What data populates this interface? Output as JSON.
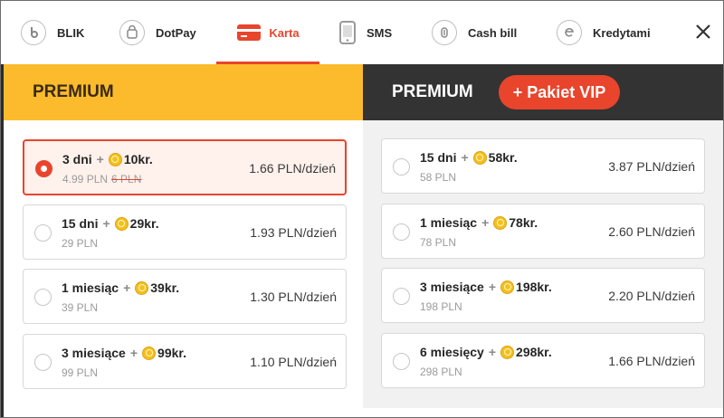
{
  "tabs": [
    {
      "label": "BLIK",
      "icon": "blik-icon"
    },
    {
      "label": "DotPay",
      "icon": "dotpay-icon"
    },
    {
      "label": "Karta",
      "icon": "card-icon",
      "active": true
    },
    {
      "label": "SMS",
      "icon": "sms-icon"
    },
    {
      "label": "Cash bill",
      "icon": "cashbill-icon"
    },
    {
      "label": "Kredytami",
      "icon": "credits-icon"
    }
  ],
  "colors": {
    "accent": "#e8452c",
    "premium_yellow": "#fbbb2c",
    "dark": "#333333",
    "coin": "#f4c01c"
  },
  "premium": {
    "title": "PREMIUM",
    "plans": [
      {
        "duration": "3 dni",
        "plus": "+",
        "credits": "10kr.",
        "price": "4.99 PLN",
        "old_price": "6 PLN",
        "per_day": "1.66 PLN/dzień",
        "selected": true
      },
      {
        "duration": "15 dni",
        "plus": "+",
        "credits": "29kr.",
        "price": "29 PLN",
        "per_day": "1.93 PLN/dzień"
      },
      {
        "duration": "1 miesiąc",
        "plus": "+",
        "credits": "39kr.",
        "price": "39 PLN",
        "per_day": "1.30 PLN/dzień"
      },
      {
        "duration": "3 miesiące",
        "plus": "+",
        "credits": "99kr.",
        "price": "99 PLN",
        "per_day": "1.10 PLN/dzień"
      }
    ]
  },
  "vip": {
    "title": "PREMIUM",
    "vip_button": "+ Pakiet VIP",
    "plans": [
      {
        "duration": "15 dni",
        "plus": "+",
        "credits": "58kr.",
        "price": "58 PLN",
        "per_day": "3.87 PLN/dzień"
      },
      {
        "duration": "1 miesiąc",
        "plus": "+",
        "credits": "78kr.",
        "price": "78 PLN",
        "per_day": "2.60 PLN/dzień"
      },
      {
        "duration": "3 miesiące",
        "plus": "+",
        "credits": "198kr.",
        "price": "198 PLN",
        "per_day": "2.20 PLN/dzień"
      },
      {
        "duration": "6 miesięcy",
        "plus": "+",
        "credits": "298kr.",
        "price": "298 PLN",
        "per_day": "1.66 PLN/dzień"
      }
    ]
  }
}
